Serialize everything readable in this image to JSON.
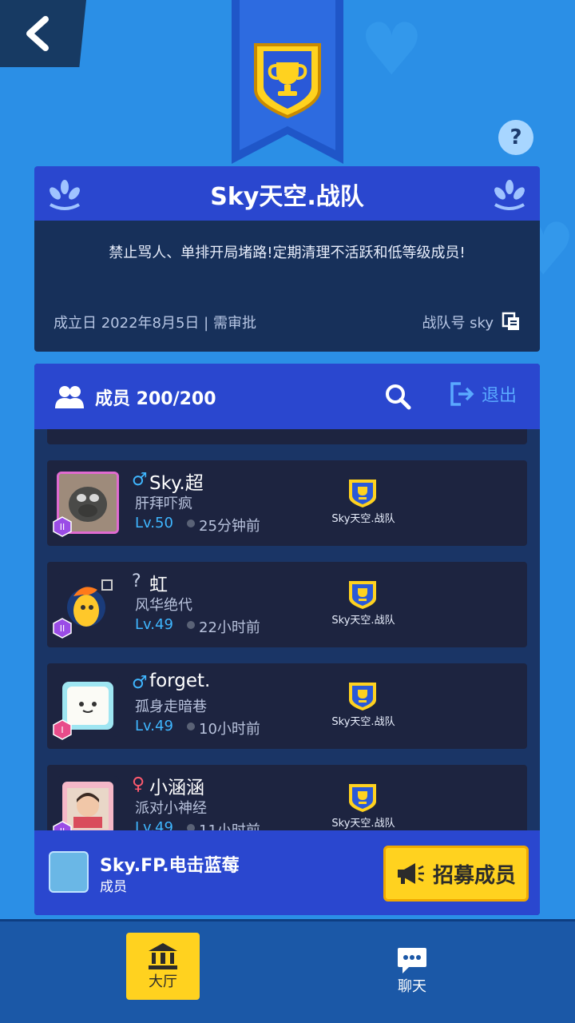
{
  "header": {
    "team_name": "Sky天空.战队",
    "motto": "禁止骂人、单排开局堵路!定期清理不活跃和低等级成员!",
    "founded": "成立日 2022年8月5日 | 需审批",
    "team_id_label": "战队号 sky",
    "help": "?"
  },
  "members": {
    "title": "成员 200/200",
    "exit_label": "退出",
    "rows": [
      {
        "gender": "♂",
        "gender_color": "#3fb6ff",
        "name": "Sky.超",
        "signature": "肝拜吓疯",
        "level": "Lv.50",
        "last_seen": "25分钟前",
        "team": "Sky天空.战队"
      },
      {
        "gender": "?",
        "gender_color": "#c7d0e6",
        "name": "虹",
        "signature": "风华绝代",
        "level": "Lv.49",
        "last_seen": "22小时前",
        "team": "Sky天空.战队"
      },
      {
        "gender": "♂",
        "gender_color": "#3fb6ff",
        "name": "forget.",
        "signature": "孤身走暗巷",
        "level": "Lv.49",
        "last_seen": "10小时前",
        "team": "Sky天空.战队"
      },
      {
        "gender": "♀",
        "gender_color": "#ff5a6e",
        "name": "小涵涵",
        "signature": "派对小神经",
        "level": "Lv.49",
        "last_seen": "11小时前",
        "team": "Sky天空.战队"
      }
    ]
  },
  "self": {
    "name": "Sky.FP.电击蓝莓",
    "role": "成员",
    "recruit_label": "招募成员"
  },
  "nav": {
    "hall_label": "大厅",
    "chat_label": "聊天"
  },
  "colors": {
    "background": "#2b8fe6",
    "panel_blue": "#2a47cf",
    "accent_yellow": "#ffd21f",
    "level_blue": "#3fb6ff"
  }
}
